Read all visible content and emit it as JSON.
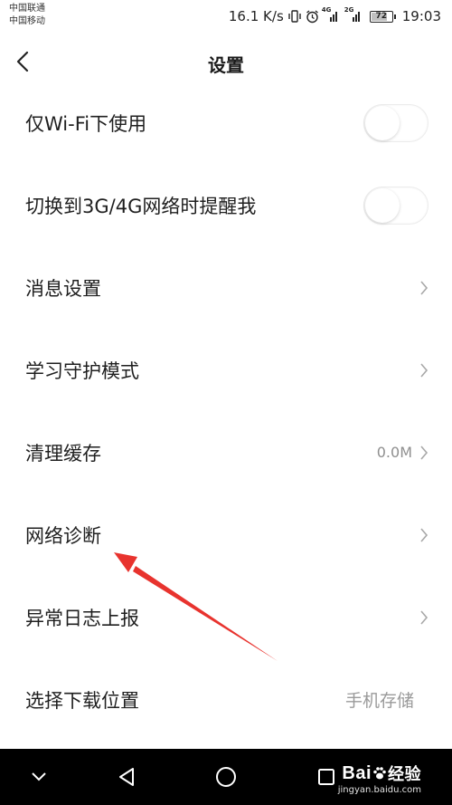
{
  "statusbar": {
    "carrier1": "中国联通",
    "carrier2": "中国移动",
    "speed": "16.1 K/s",
    "net1": "4G",
    "net2": "2G",
    "battery": "72",
    "time": "19:03"
  },
  "header": {
    "title": "设置"
  },
  "settings": [
    {
      "label": "仅Wi-Fi下使用",
      "control": "toggle",
      "on": false
    },
    {
      "label": "切换到3G/4G网络时提醒我",
      "control": "toggle",
      "on": false
    },
    {
      "label": "消息设置",
      "control": "chevron"
    },
    {
      "label": "学习守护模式",
      "control": "chevron"
    },
    {
      "label": "清理缓存",
      "control": "chevron",
      "value": "0.0M"
    },
    {
      "label": "网络诊断",
      "control": "chevron"
    },
    {
      "label": "异常日志上报",
      "control": "chevron"
    },
    {
      "label": "选择下载位置",
      "control": "value",
      "value": "手机存储"
    }
  ],
  "watermark": {
    "brand_left": "Bai",
    "brand_right": "经验",
    "url": "jingyan.baidu.com"
  },
  "colors": {
    "annotation_arrow": "#e8332e",
    "navbar": "#000000"
  }
}
